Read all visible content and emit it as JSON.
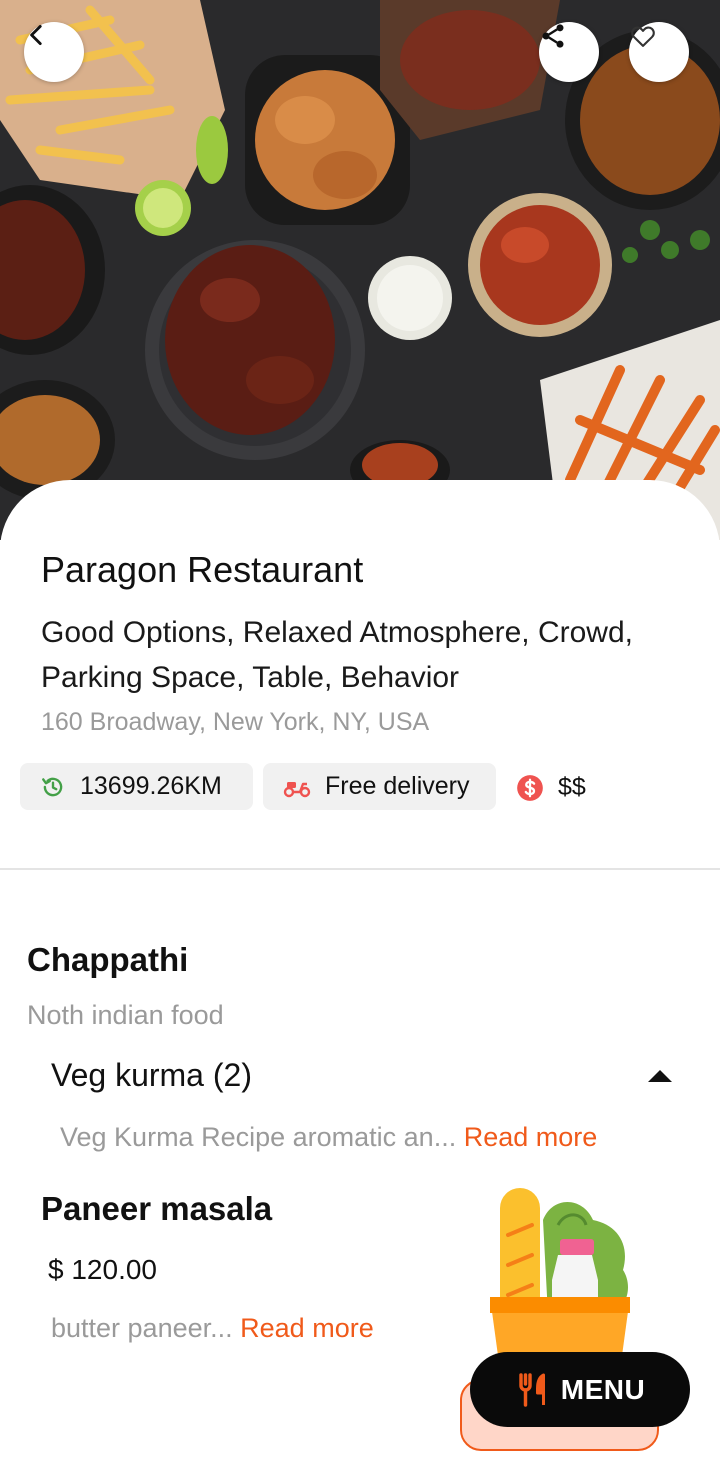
{
  "header": {
    "back_icon": "chevron-left-icon",
    "share_icon": "share-icon",
    "favorite_icon": "heart-outline-icon"
  },
  "restaurant": {
    "name": "Paragon Restaurant",
    "tags": "Good Options, Relaxed Atmosphere, Crowd, Parking Space, Table, Behavior",
    "address": "160 Broadway, New York, NY, USA",
    "distance": "13699.26KM",
    "delivery": "Free delivery",
    "price_level": "$$"
  },
  "category": {
    "title": "Chappathi",
    "subtitle": "Noth indian food"
  },
  "group": {
    "title": "Veg kurma (2)",
    "item_desc": "Veg Kurma Recipe aromatic an...",
    "read_more": "Read more"
  },
  "dish": {
    "name": "Paneer masala",
    "price": "$ 120.00",
    "desc": "butter paneer...",
    "read_more": "Read more"
  },
  "menu_button": {
    "label": "MENU"
  },
  "colors": {
    "accent": "#f05a1a",
    "delivery_icon": "#ef5350",
    "distance_icon": "#43a047",
    "price_icon": "#ef5350",
    "menu_button_bg": "#0a0a0a"
  }
}
